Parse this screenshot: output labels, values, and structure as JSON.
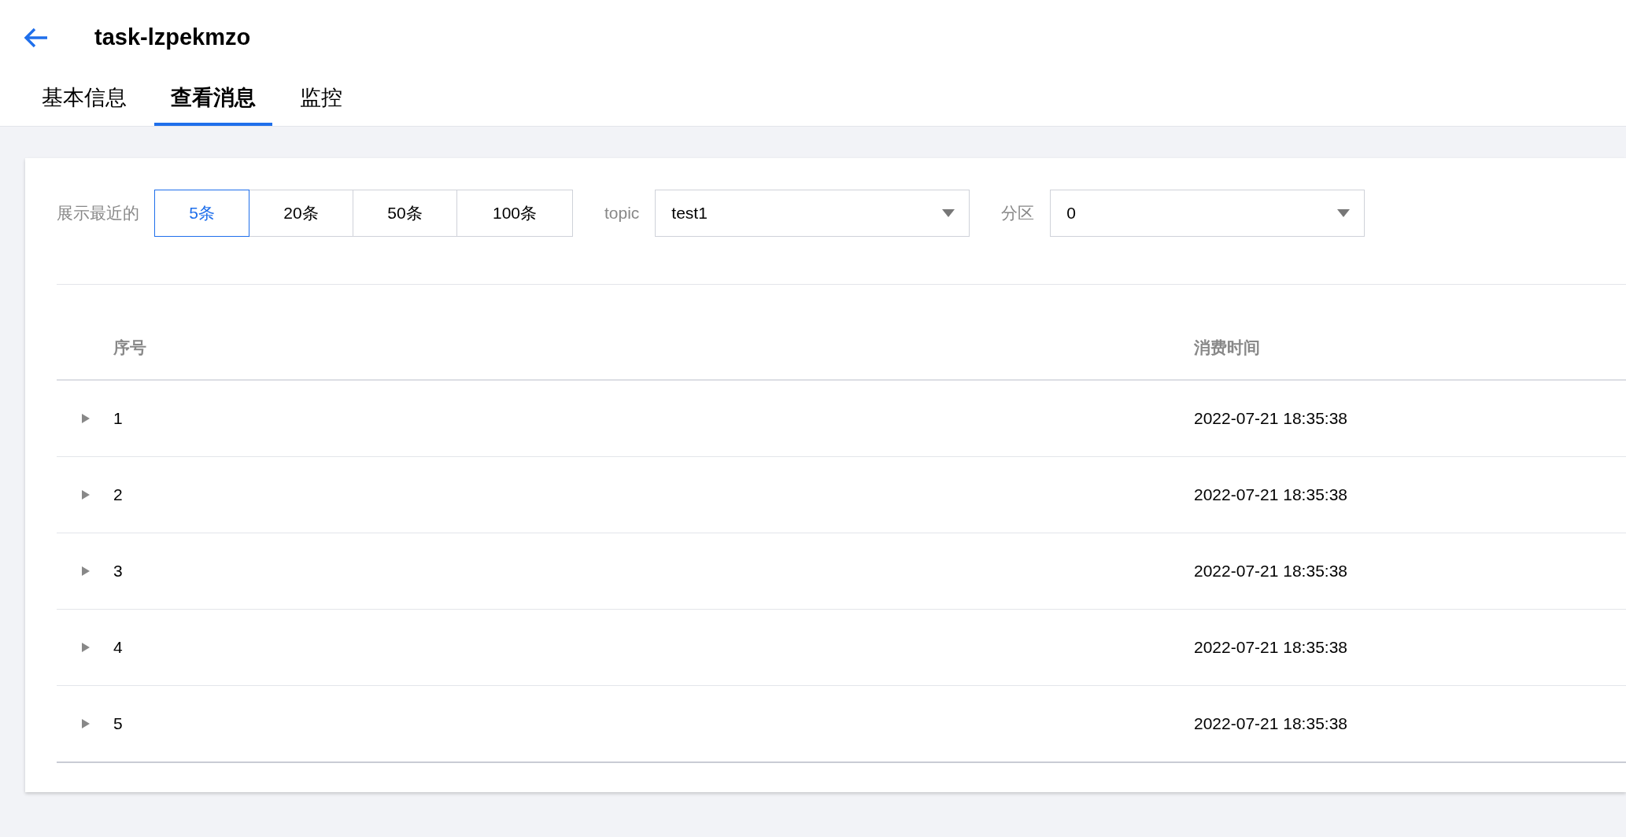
{
  "header": {
    "title": "task-lzpekmzo"
  },
  "tabs": [
    {
      "label": "基本信息",
      "selected": false
    },
    {
      "label": "查看消息",
      "selected": true
    },
    {
      "label": "监控",
      "selected": false
    }
  ],
  "filters": {
    "recent_label": "展示最近的",
    "recent_options": [
      {
        "label": "5条",
        "selected": true
      },
      {
        "label": "20条",
        "selected": false
      },
      {
        "label": "50条",
        "selected": false
      },
      {
        "label": "100条",
        "selected": false
      }
    ],
    "topic": {
      "label": "topic",
      "value": "test1"
    },
    "partition": {
      "label": "分区",
      "value": "0"
    }
  },
  "table": {
    "columns": [
      "序号",
      "消费时间"
    ],
    "rows": [
      {
        "index": "1",
        "time": "2022-07-21 18:35:38",
        "expanded": false
      },
      {
        "index": "2",
        "time": "2022-07-21 18:35:38",
        "expanded": false
      },
      {
        "index": "3",
        "time": "2022-07-21 18:35:38",
        "expanded": false
      },
      {
        "index": "4",
        "time": "2022-07-21 18:35:38",
        "expanded": false
      },
      {
        "index": "5",
        "time": "2022-07-21 18:35:38",
        "expanded": false
      }
    ]
  }
}
